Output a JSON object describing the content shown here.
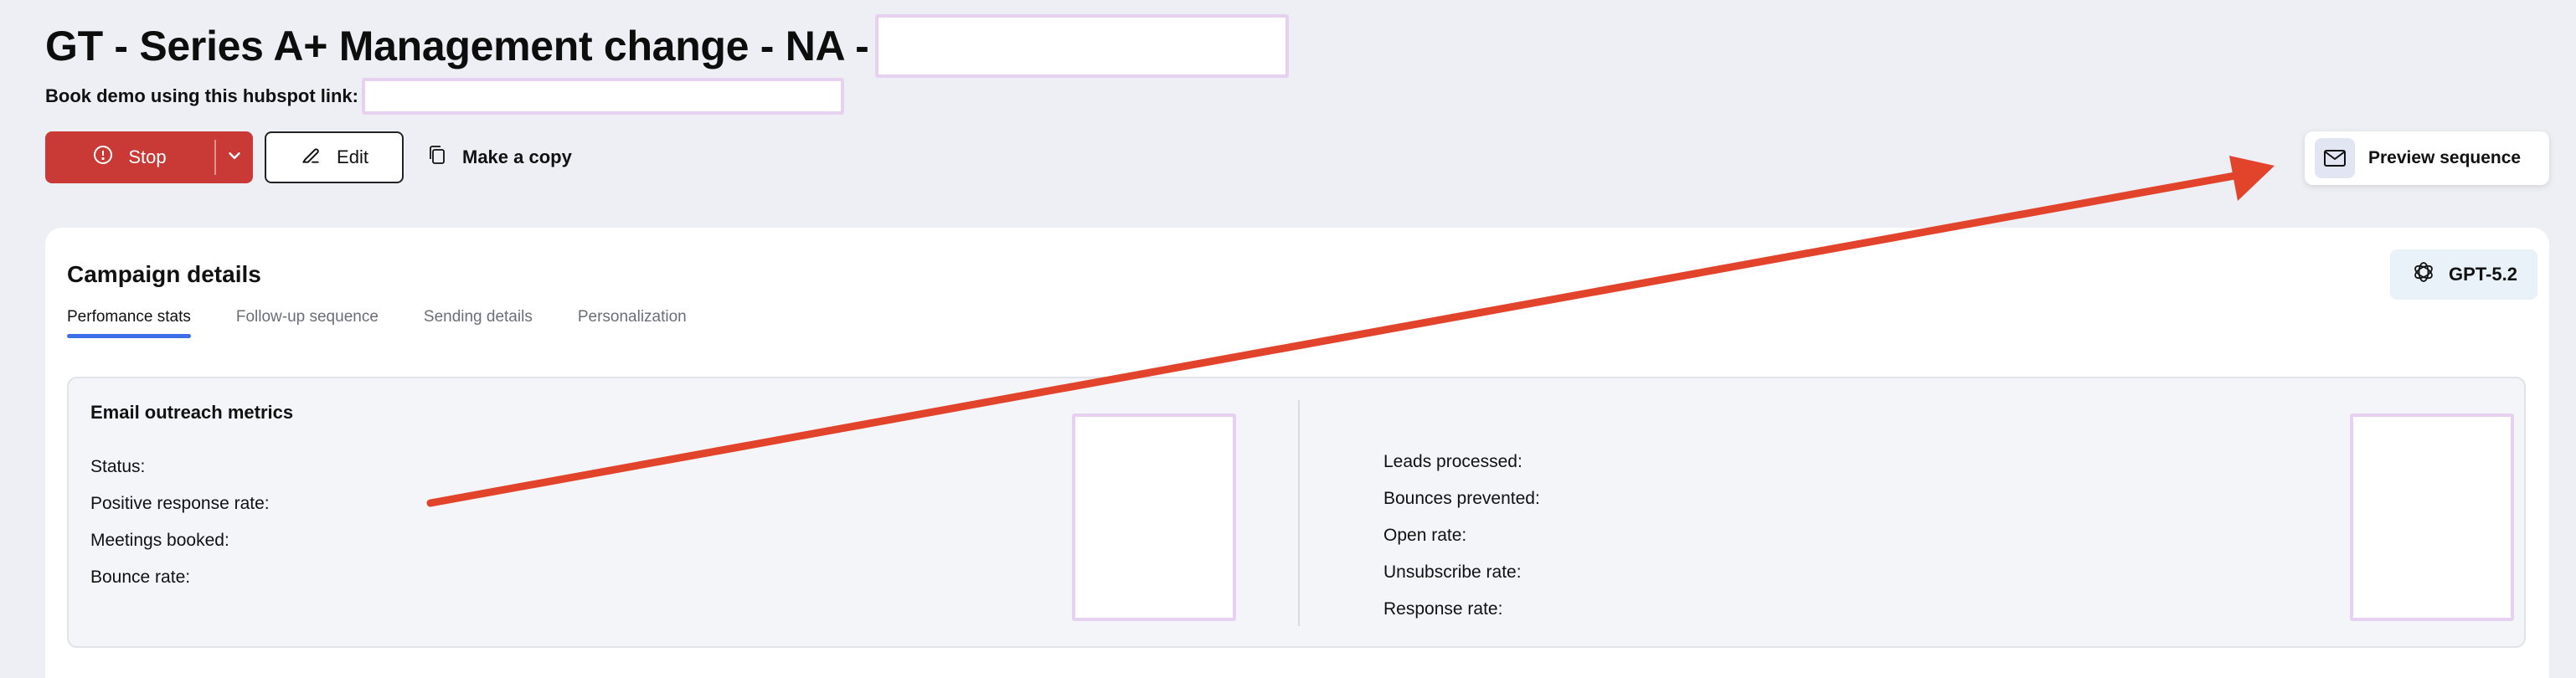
{
  "header": {
    "title": "GT - Series A+ Management change - NA -",
    "subtitle": "Book demo using this hubspot link:"
  },
  "toolbar": {
    "stop_label": "Stop",
    "edit_label": "Edit",
    "copy_label": "Make a copy",
    "preview_label": "Preview sequence"
  },
  "card": {
    "title": "Campaign details",
    "model_badge": "GPT-5.2",
    "tabs": [
      {
        "label": "Perfomance stats",
        "active": true
      },
      {
        "label": "Follow-up sequence",
        "active": false
      },
      {
        "label": "Sending details",
        "active": false
      },
      {
        "label": "Personalization",
        "active": false
      }
    ]
  },
  "metrics": {
    "title": "Email outreach metrics",
    "left": [
      "Status:",
      "Positive response rate:",
      "Meetings booked:",
      "Bounce rate:"
    ],
    "right": [
      "Leads processed:",
      "Bounces prevented:",
      "Open rate:",
      "Unsubscribe rate:",
      "Response rate:"
    ]
  },
  "colors": {
    "page_bg": "#eeeff4",
    "stop_red": "#c93a37",
    "tab_underline": "#3d6ee8",
    "annotation_arrow": "#e2432b",
    "redaction_border": "#e6d1f0"
  },
  "icons": {
    "stop": "stop-info-icon",
    "caret": "chevron-down-icon",
    "edit": "pencil-icon",
    "copy": "copy-icon",
    "preview": "envelope-icon",
    "model": "openai-logo-icon"
  }
}
